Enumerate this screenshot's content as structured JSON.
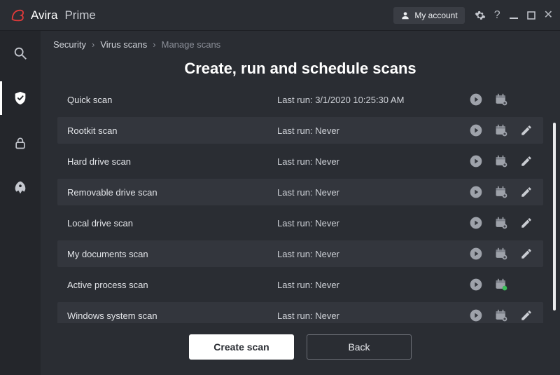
{
  "brand": {
    "name": "Avira",
    "product": "Prime"
  },
  "account_label": "My account",
  "breadcrumbs": {
    "a": "Security",
    "b": "Virus scans",
    "c": "Manage scans"
  },
  "title": "Create, run and schedule scans",
  "last_run_prefix": "Last run: ",
  "scans": [
    {
      "name": "Quick scan",
      "last_run": "3/1/2020 10:25:30 AM",
      "editable": false,
      "calendar_active": false
    },
    {
      "name": "Rootkit scan",
      "last_run": "Never",
      "editable": true,
      "calendar_active": false
    },
    {
      "name": "Hard drive scan",
      "last_run": "Never",
      "editable": true,
      "calendar_active": false
    },
    {
      "name": "Removable drive scan",
      "last_run": "Never",
      "editable": true,
      "calendar_active": false
    },
    {
      "name": "Local drive scan",
      "last_run": "Never",
      "editable": true,
      "calendar_active": false
    },
    {
      "name": "My documents scan",
      "last_run": "Never",
      "editable": true,
      "calendar_active": false
    },
    {
      "name": "Active process scan",
      "last_run": "Never",
      "editable": false,
      "calendar_active": true
    },
    {
      "name": "Windows system scan",
      "last_run": "Never",
      "editable": true,
      "calendar_active": false
    }
  ],
  "buttons": {
    "create": "Create scan",
    "back": "Back"
  }
}
